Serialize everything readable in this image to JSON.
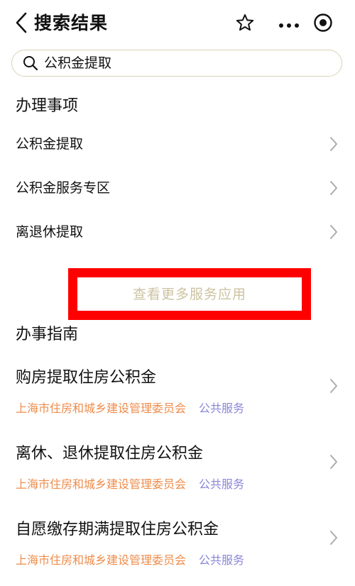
{
  "header": {
    "title": "搜索结果",
    "icons": {
      "back": "chevron-left-icon",
      "favorite": "star-icon",
      "more": "more-dots-icon",
      "mini_program": "target-icon"
    }
  },
  "search": {
    "value": "公积金提取",
    "icon": "search-icon"
  },
  "sections": {
    "services": {
      "title": "办理事项",
      "items": [
        {
          "label": "公积金提取"
        },
        {
          "label": "公积金服务专区"
        },
        {
          "label": "离退休提取"
        }
      ],
      "more_label": "查看更多服务应用"
    },
    "guides": {
      "title": "办事指南",
      "items": [
        {
          "title": "购房提取住房公积金",
          "org": "上海市住房和城乡建设管理委员会",
          "category": "公共服务"
        },
        {
          "title": "离休、退休提取住房公积金",
          "org": "上海市住房和城乡建设管理委员会",
          "category": "公共服务"
        },
        {
          "title": "自愿缴存期满提取住房公积金",
          "org": "上海市住房和城乡建设管理委员会",
          "category": "公共服务"
        }
      ]
    }
  },
  "colors": {
    "highlight_border": "#ff0000",
    "more_text": "#ccc3a1",
    "org_text": "#ee8c4b",
    "category_text": "#8a86d8",
    "search_border": "#d9d3b5"
  }
}
